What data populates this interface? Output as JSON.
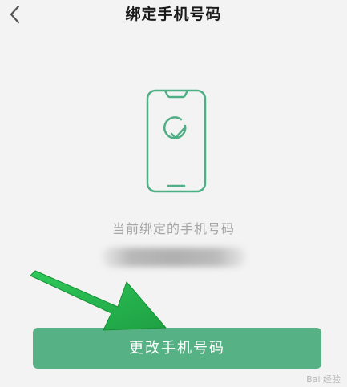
{
  "header": {
    "title": "绑定手机号码",
    "back_icon": "chevron-left-icon"
  },
  "main": {
    "illustration_icon": "phone-check-icon",
    "caption": "当前绑定的手机号码",
    "masked_number": ""
  },
  "actions": {
    "change_label": "更改手机号码"
  },
  "colors": {
    "accent": "#56b184",
    "illustration": "#4fae86",
    "annotation_arrow": "#22b14c"
  },
  "watermark": {
    "text": "Bai 经验"
  }
}
